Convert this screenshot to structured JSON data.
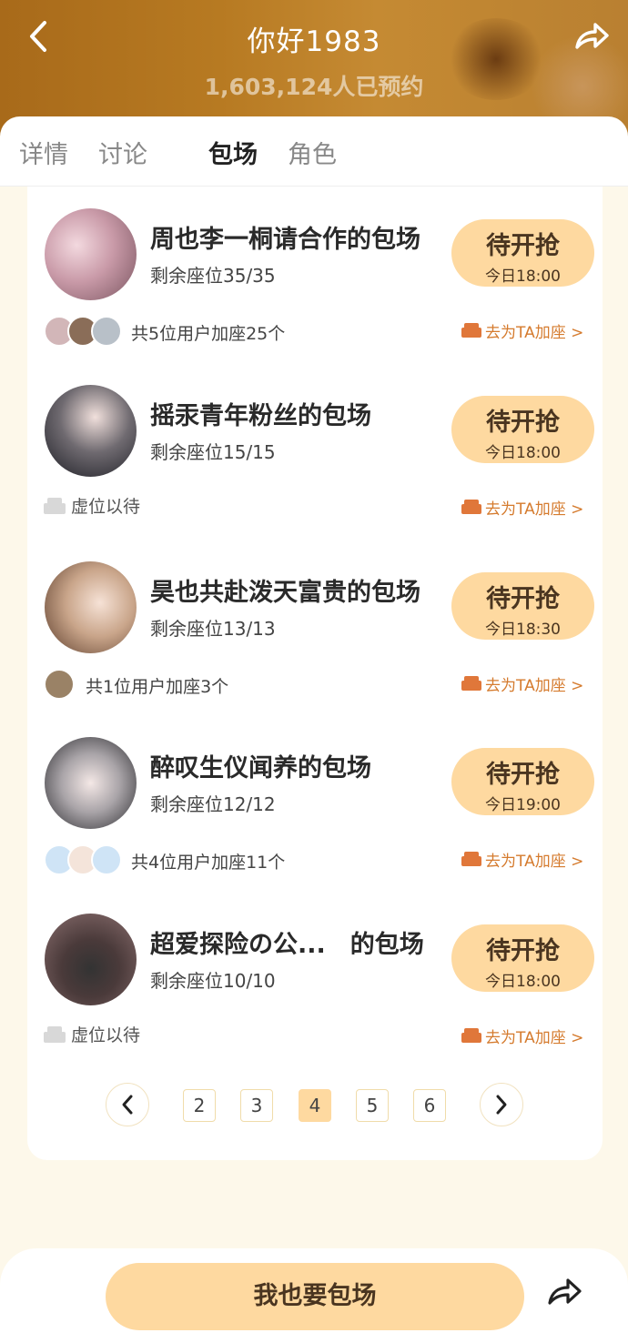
{
  "header": {
    "title": "你好1983",
    "subtitle": "1,603,124人已预约",
    "back_icon": "chevron-left-icon",
    "share_icon": "share-arrow-icon"
  },
  "tabs": [
    {
      "label": "详情",
      "active": false
    },
    {
      "label": "讨论",
      "active": false
    },
    {
      "label": "包场",
      "active": true
    },
    {
      "label": "角色",
      "active": false
    }
  ],
  "items": [
    {
      "title": "周也李一桐请合作的包场",
      "seats": "剩余座位35/35",
      "button_label": "待开抢",
      "button_time": "今日18:00",
      "users_text": "共5位用户加座25个",
      "wait_text": "",
      "seat_link": "去为TA加座 >"
    },
    {
      "title": "摇汞青年粉丝的包场",
      "seats": "剩余座位15/15",
      "button_label": "待开抢",
      "button_time": "今日18:00",
      "users_text": "",
      "wait_text": "虚位以待",
      "seat_link": "去为TA加座 >"
    },
    {
      "title": "昊也共赴泼天富贵的包场",
      "seats": "剩余座位13/13",
      "button_label": "待开抢",
      "button_time": "今日18:30",
      "users_text": "共1位用户加座3个",
      "wait_text": "",
      "seat_link": "去为TA加座 >"
    },
    {
      "title": "醉叹生仪闻养的包场",
      "seats": "剩余座位12/12",
      "button_label": "待开抢",
      "button_time": "今日19:00",
      "users_text": "共4位用户加座11个",
      "wait_text": "",
      "seat_link": "去为TA加座 >"
    },
    {
      "title": "超爱探险の公...　的包场",
      "seats": "剩余座位10/10",
      "button_label": "待开抢",
      "button_time": "今日18:00",
      "users_text": "",
      "wait_text": "虚位以待",
      "seat_link": "去为TA加座 >"
    }
  ],
  "pagination": {
    "pages": [
      "2",
      "3",
      "4",
      "5",
      "6"
    ],
    "current": "4",
    "prev_icon": "chevron-left-icon",
    "next_icon": "chevron-right-icon"
  },
  "bottom": {
    "cta_label": "我也要包场",
    "share_icon": "share-arrow-icon"
  },
  "colors": {
    "accent": "#fed9a0",
    "link": "#d57b2e",
    "page_bg": "#fdf8ea"
  }
}
